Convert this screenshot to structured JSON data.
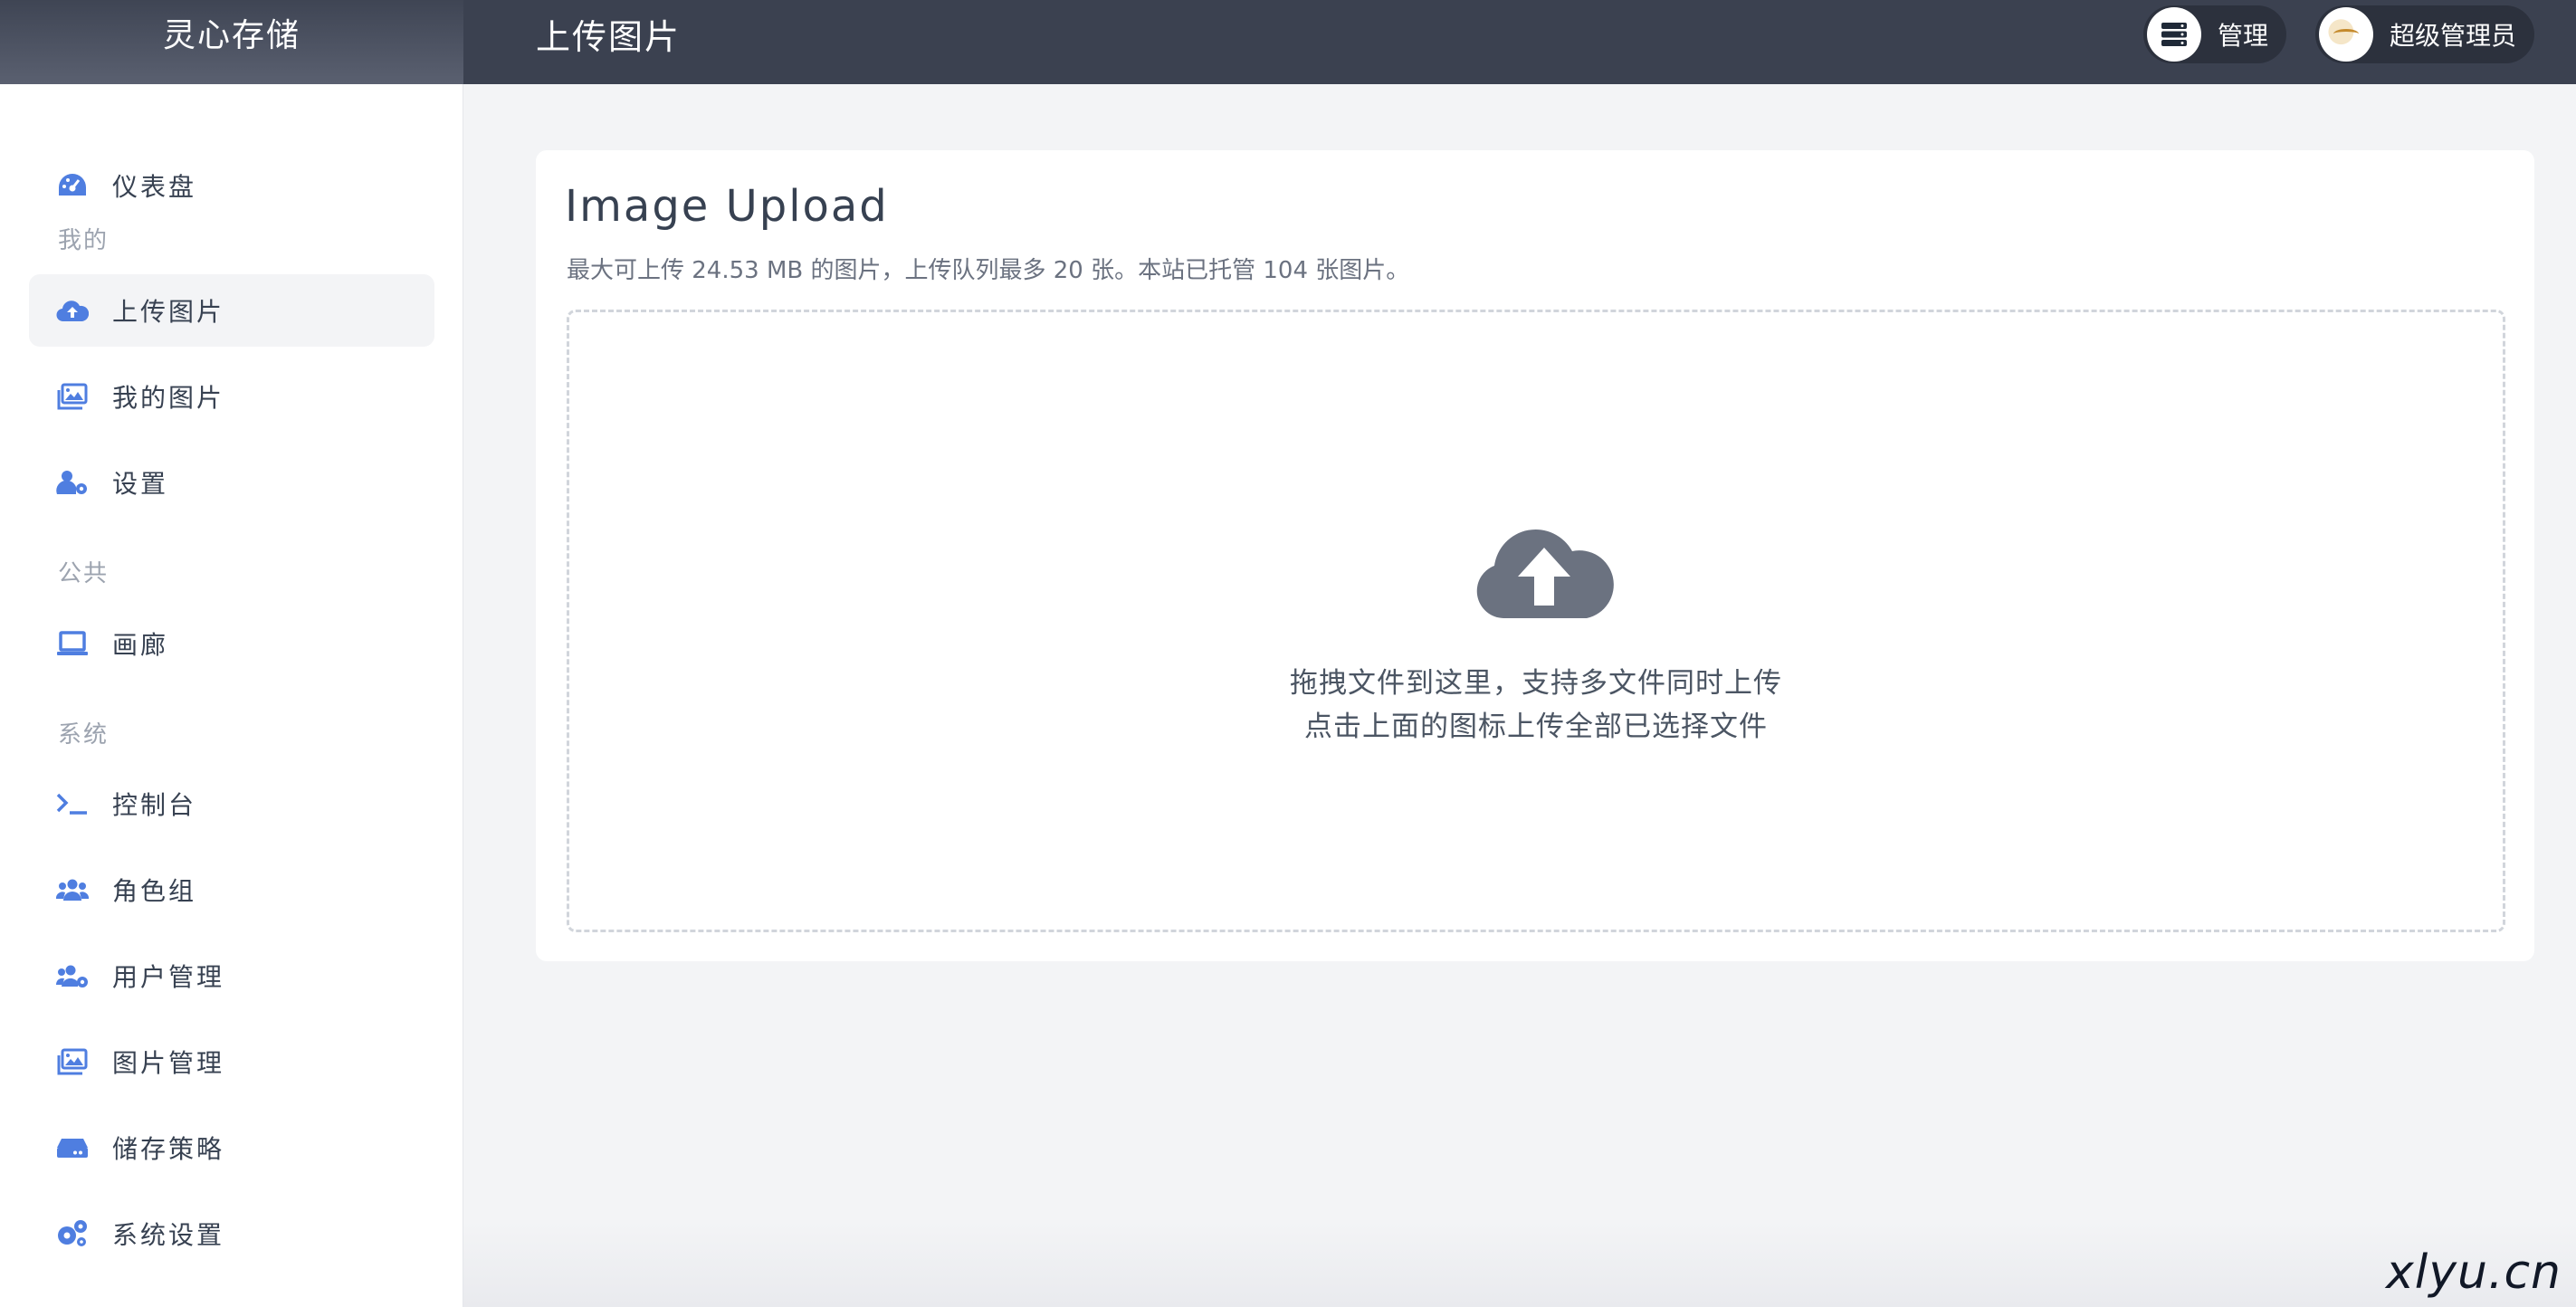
{
  "app": {
    "title": "灵心存储",
    "page_title": "上传图片"
  },
  "header": {
    "manage_label": "管理",
    "user_label": "超级管理员"
  },
  "sidebar": {
    "dashboard": "仪表盘",
    "section_mine": "我的",
    "upload": "上传图片",
    "my_images": "我的图片",
    "settings": "设置",
    "section_public": "公共",
    "gallery": "画廊",
    "section_system": "系统",
    "console": "控制台",
    "roles": "角色组",
    "users": "用户管理",
    "image_admin": "图片管理",
    "storage": "储存策略",
    "system_settings": "系统设置"
  },
  "upload_card": {
    "title": "Image Upload",
    "description": "最大可上传 24.53 MB 的图片，上传队列最多 20 张。本站已托管 104 张图片。",
    "drop_line1": "拖拽文件到这里，支持多文件同时上传",
    "drop_line2": "点击上面的图标上传全部已选择文件"
  },
  "watermark": "xlyu.cn",
  "colors": {
    "accent": "#4f7ee0",
    "header_bg": "#3b4150",
    "cloud": "#6b7280"
  }
}
